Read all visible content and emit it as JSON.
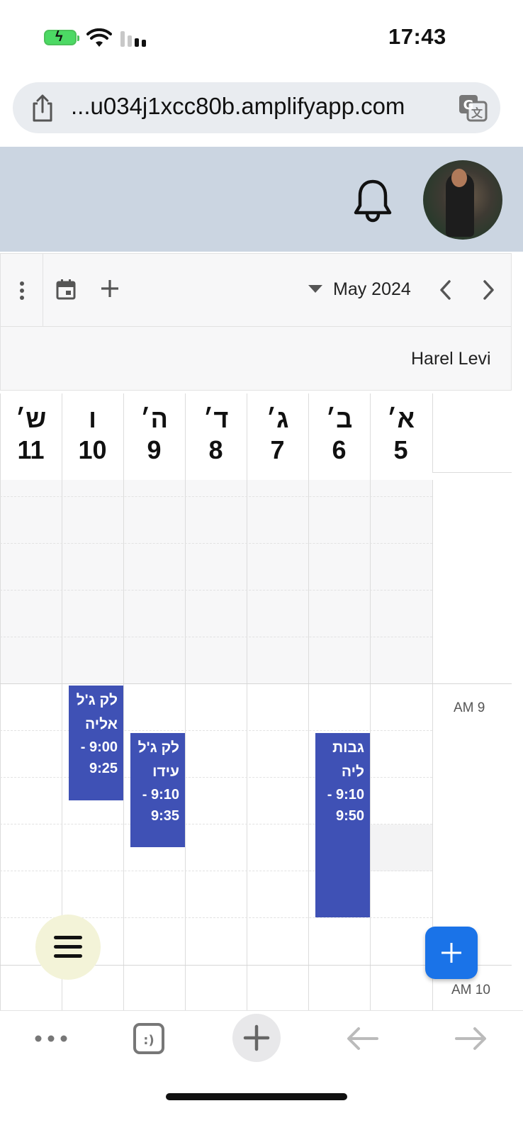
{
  "status_bar": {
    "time": "17:43"
  },
  "browser": {
    "url": "...u034j1xcc80b.amplifyapp.com"
  },
  "toolbar": {
    "month": "May 2024"
  },
  "resource": {
    "name": "Harel Levi"
  },
  "days": [
    {
      "name": "ש׳",
      "num": "11"
    },
    {
      "name": "ו",
      "num": "10"
    },
    {
      "name": "ה׳",
      "num": "9"
    },
    {
      "name": "ד׳",
      "num": "8"
    },
    {
      "name": "ג׳",
      "num": "7"
    },
    {
      "name": "ב׳",
      "num": "6"
    },
    {
      "name": "א׳",
      "num": "5"
    }
  ],
  "time_labels": [
    "AM 9",
    "AM 10"
  ],
  "events": [
    {
      "title_line1": "לק ג'ל",
      "title_line2": "אליה",
      "time_line1": "9:00 -",
      "time_line2": "9:25",
      "day": "10",
      "start": "9:00",
      "end": "9:25"
    },
    {
      "title_line1": "לק ג'ל",
      "title_line2": "עידו",
      "time_line1": "9:10 -",
      "time_line2": "9:35",
      "day": "9",
      "start": "9:10",
      "end": "9:35"
    },
    {
      "title_line1": "גבות",
      "title_line2": "ליה",
      "time_line1": "9:10 -",
      "time_line2": "9:50",
      "day": "6",
      "start": "9:10",
      "end": "9:50"
    }
  ],
  "colors": {
    "event": "#3f51b5",
    "fab": "#1a73e8",
    "header_bg": "#cbd5e1",
    "menu_button": "#f3f3d8"
  },
  "icons": [
    "battery-icon",
    "wifi-icon",
    "signal-icon",
    "share-icon",
    "translate-icon",
    "bell-icon",
    "kebab-icon",
    "calendar-icon",
    "add-icon",
    "dropdown-icon",
    "chevron-left-icon",
    "chevron-right-icon",
    "plus-icon",
    "hamburger-icon",
    "more-icon",
    "tabs-icon",
    "back-icon",
    "forward-icon"
  ]
}
